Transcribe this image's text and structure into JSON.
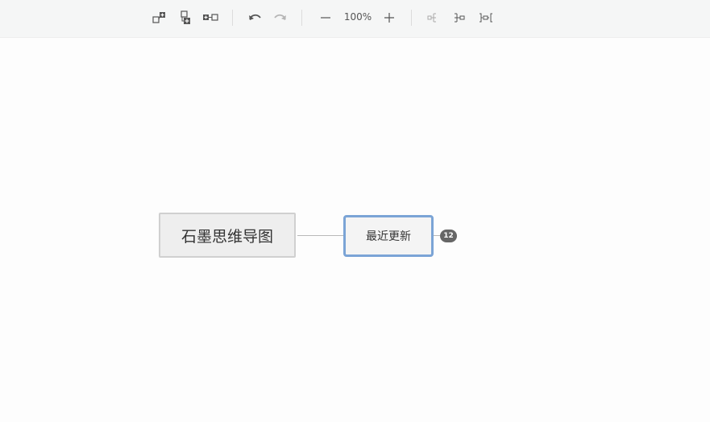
{
  "toolbar": {
    "zoom_level": "100%",
    "buttons": [
      {
        "name": "insert-child-topic",
        "icon": "add-child-icon"
      },
      {
        "name": "insert-sibling-topic",
        "icon": "add-sibling-icon"
      },
      {
        "name": "insert-parent-topic",
        "icon": "add-parent-icon"
      },
      {
        "name": "undo",
        "icon": "undo-icon"
      },
      {
        "name": "redo",
        "icon": "redo-icon"
      },
      {
        "name": "zoom-out",
        "icon": "minus-icon"
      },
      {
        "name": "zoom-in",
        "icon": "plus-icon"
      },
      {
        "name": "layout-right",
        "icon": "layout-right-icon"
      },
      {
        "name": "layout-left",
        "icon": "layout-left-icon"
      },
      {
        "name": "layout-both",
        "icon": "layout-both-icon"
      }
    ]
  },
  "mindmap": {
    "root": {
      "label": "石墨思维导图"
    },
    "children": [
      {
        "label": "最近更新",
        "collapsed_count": "12",
        "selected": true
      }
    ]
  },
  "colors": {
    "toolbar_bg": "#f5f6f6",
    "selected_border": "#7ba4d6",
    "root_bg": "#eeeeee",
    "badge_bg": "#666666"
  }
}
